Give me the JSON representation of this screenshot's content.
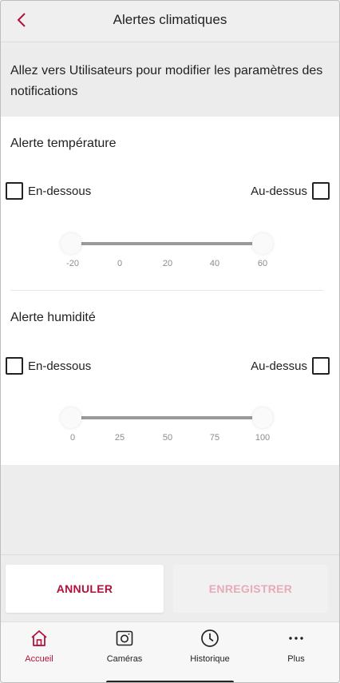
{
  "header": {
    "title": "Alertes climatiques"
  },
  "info": {
    "text": "Allez vers Utilisateurs pour modifier les paramètres des notifications"
  },
  "temperature": {
    "title": "Alerte température",
    "below_label": "En-dessous",
    "above_label": "Au-dessus",
    "below_checked": false,
    "above_checked": false,
    "ticks": [
      "-20",
      "0",
      "20",
      "40",
      "60"
    ],
    "range_min": -20,
    "range_max": 60
  },
  "humidity": {
    "title": "Alerte humidité",
    "below_label": "En-dessous",
    "above_label": "Au-dessus",
    "below_checked": false,
    "above_checked": false,
    "ticks": [
      "0",
      "25",
      "50",
      "75",
      "100"
    ],
    "range_min": 0,
    "range_max": 100
  },
  "actions": {
    "cancel_label": "ANNULER",
    "save_label": "ENREGISTRER"
  },
  "nav": {
    "items": [
      {
        "label": "Accueil",
        "icon": "home-icon",
        "active": true
      },
      {
        "label": "Caméras",
        "icon": "camera-icon",
        "active": false
      },
      {
        "label": "Historique",
        "icon": "clock-icon",
        "active": false
      },
      {
        "label": "Plus",
        "icon": "more-icon",
        "active": false
      }
    ]
  },
  "colors": {
    "accent": "#b0123c",
    "accent_disabled": "#e7aab9",
    "background": "#ededed"
  }
}
